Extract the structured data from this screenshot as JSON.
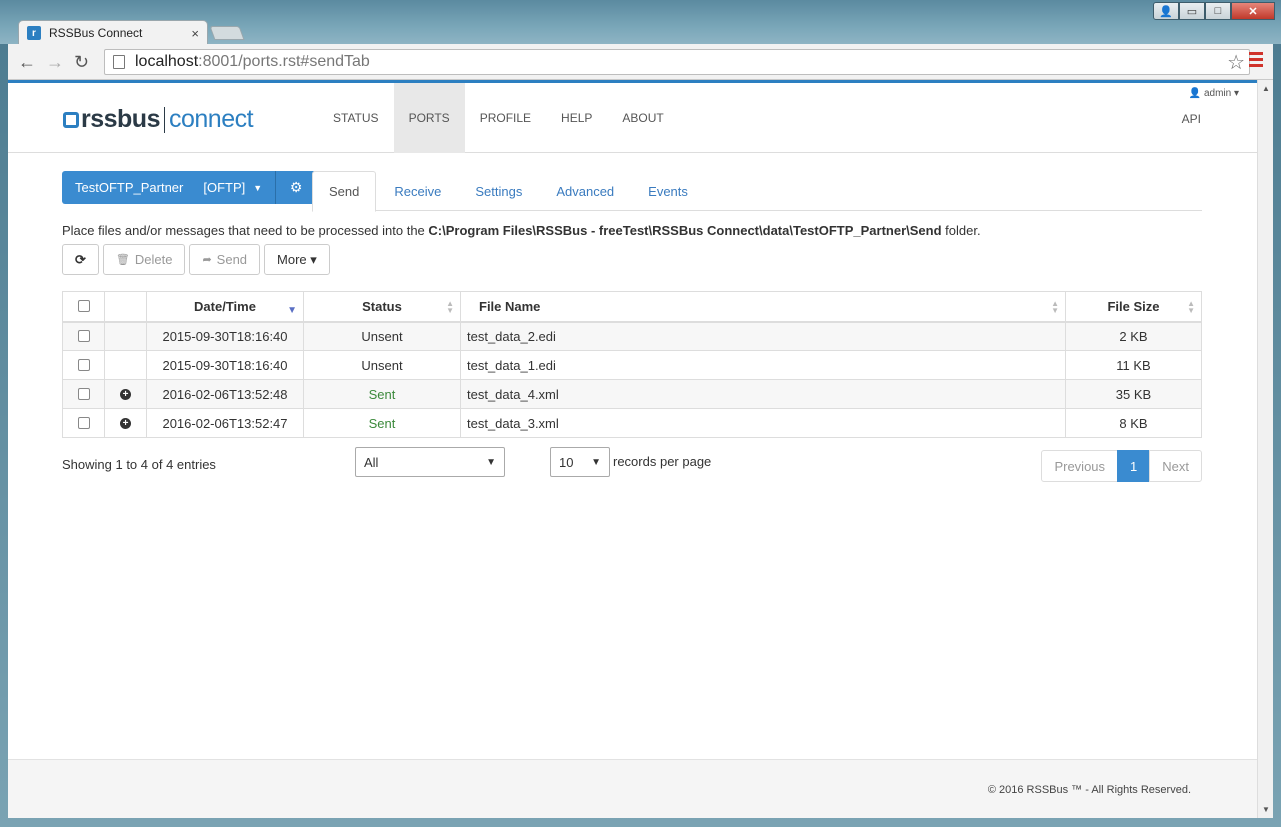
{
  "browser": {
    "tab_title": "RSSBus Connect",
    "tab_close": "×",
    "url_host": "localhost",
    "url_path": ":8001/ports.rst#sendTab",
    "back": "←",
    "forward": "→",
    "reload": "↻",
    "star": "☆"
  },
  "window": {
    "user": "👤",
    "minimize": "▭",
    "maximize": "□",
    "close": "✕"
  },
  "header": {
    "logo_rss": "rssbus",
    "logo_connect": "connect",
    "nav": [
      "STATUS",
      "PORTS",
      "PROFILE",
      "HELP",
      "ABOUT"
    ],
    "active_nav": "PORTS",
    "admin": "admin ▾",
    "api": "API"
  },
  "port": {
    "name": "TestOFTP_Partner",
    "type": "[OFTP]",
    "caret": "▼",
    "gear": "⚙"
  },
  "tabs": [
    "Send",
    "Receive",
    "Settings",
    "Advanced",
    "Events"
  ],
  "info": {
    "prefix": "Place files and/or messages that need to be processed into the ",
    "path": "C:\\Program Files\\RSSBus - freeTest\\RSSBus Connect\\data\\TestOFTP_Partner\\Send",
    "suffix": " folder."
  },
  "buttons": {
    "refresh": "⟳",
    "delete_icon": "🗑",
    "delete": "Delete",
    "send_icon": "➦",
    "send": "Send",
    "more": "More ▾"
  },
  "table": {
    "headers": {
      "datetime": "Date/Time",
      "status": "Status",
      "filename": "File Name",
      "filesize": "File Size"
    },
    "rows": [
      {
        "datetime": "2015-09-30T18:16:40",
        "status": "Unsent",
        "filename": "test_data_2.edi",
        "filesize": "2 KB",
        "expand": ""
      },
      {
        "datetime": "2015-09-30T18:16:40",
        "status": "Unsent",
        "filename": "test_data_1.edi",
        "filesize": "11 KB",
        "expand": ""
      },
      {
        "datetime": "2016-02-06T13:52:48",
        "status": "Sent",
        "filename": "test_data_4.xml",
        "filesize": "35 KB",
        "expand": "+"
      },
      {
        "datetime": "2016-02-06T13:52:47",
        "status": "Sent",
        "filename": "test_data_3.xml",
        "filesize": "8 KB",
        "expand": "+"
      }
    ]
  },
  "paging": {
    "showing": "Showing 1 to 4 of 4 entries",
    "filter": "All",
    "per_page": "10",
    "per_page_label": "records per page",
    "previous": "Previous",
    "current": "1",
    "next": "Next"
  },
  "footer": {
    "copyright": "© 2016 RSSBus ™ - All Rights Reserved."
  },
  "colors": {
    "accent": "#3a8bd0",
    "sent": "#3c8a3c"
  }
}
